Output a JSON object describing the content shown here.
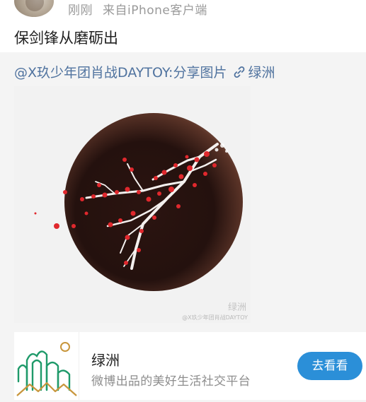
{
  "post": {
    "time": "刚刚",
    "source": "来自iPhone客户端",
    "text": "保剑锋从磨砺出"
  },
  "retweet": {
    "mention": "@X玖少年团肖战DAYTOY",
    "colon_text": ":分享图片",
    "link_label": "绿洲"
  },
  "image": {
    "watermark": "@X玖少年团肖战DAYTOY",
    "watermark_logo": "绿洲"
  },
  "card": {
    "title": "绿洲",
    "description": "微博出品的美好生活社交平台",
    "button_label": "去看看"
  },
  "icons": {
    "link": "link-icon",
    "avatar": "avatar",
    "app_logo": "oasis-logo-icon"
  },
  "colors": {
    "link_blue": "#50739f",
    "button_blue": "#2b8fd8",
    "logo_green": "#1f9a6a",
    "logo_gold": "#c8963c"
  }
}
